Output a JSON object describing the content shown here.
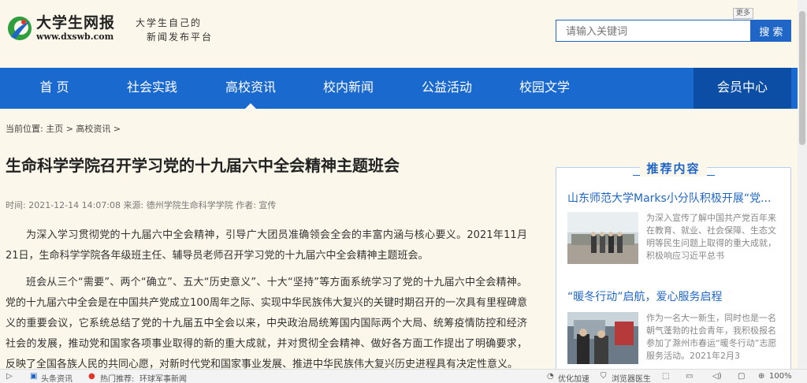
{
  "header": {
    "logo_name": "大学生网报",
    "logo_url": "www.dxswb.com",
    "slogan_line1": "大学生自己的",
    "slogan_line2": "新闻发布平台",
    "more_label": "更多",
    "search_placeholder": "请输入关键词",
    "search_button": "搜 索"
  },
  "nav": {
    "items": [
      "首  页",
      "社会实践",
      "高校资讯",
      "校内新闻",
      "公益活动",
      "校园文学"
    ],
    "active": "高校资讯",
    "member": "会员中心"
  },
  "breadcrumb": "当前位置: 主页 > 高校资讯 >",
  "article": {
    "title": "生命科学学院召开学习党的十九届六中全会精神主题班会",
    "meta": "时间: 2021-12-14 14:07:08 来源: 德州学院生命科学学院 作者: 宣传",
    "paragraphs": [
      "为深入学习贯彻党的十九届六中全会精神，引导广大团员准确领会全会的丰富内涵与核心要义。2021年11月21日，生命科学学院各年级班主任、辅导员老师召开学习党的十九届六中全会精神主题班会。",
      "班会从三个“需要”、两个“确立”、五大“历史意义”、十大“坚持”等方面系统学习了党的十九届六中全会精神。党的十九届六中全会是在中国共产党成立100周年之际、实现中华民族伟大复兴的关键时期召开的一次具有里程碑意义的重要会议，它系统总结了党的十九届五中全会以来，中央政治局统筹国内国际两个大局、统筹疫情防控和经济社会的发展，推动党和国家各项事业取得的新的重大成就，并对贯彻全会精神、做好各方面工作提出了明确要求，反映了全国各族人民的共同心愿，对新时代党和国家事业发展、推进中华民族伟大复兴历史进程具有决定性意义。"
    ]
  },
  "sidebar": {
    "title": "推荐内容",
    "items": [
      {
        "title": "山东师范大学Marks小分队积极开展“党...",
        "desc": "为深入宣传了解中国共产党百年来在教育、就业、社会保障、生态文明等民生问题上取得的重大成就，积极响应习近平总书"
      },
      {
        "title": "“暖冬行动”启航，爱心服务启程",
        "desc": "作为一名大一新生，同时也是一名朝气蓬勃的社会青年，我积极报名参加了滁州市春运“暖冬行动”志愿服务活动。2021年2月3"
      }
    ]
  },
  "statusbar": {
    "toutiao": "头条资讯",
    "hot_label": "热门推荐:",
    "hot_text": "环球军事新闻",
    "optimize": "优化加速",
    "doctor": "浏览器医生",
    "zoom": "100%"
  },
  "colors": {
    "nav_blue": "#1a69ce",
    "member_blue": "#0c4ea6",
    "accent": "#1f66c7",
    "page_bg": "#fbf7ea"
  }
}
